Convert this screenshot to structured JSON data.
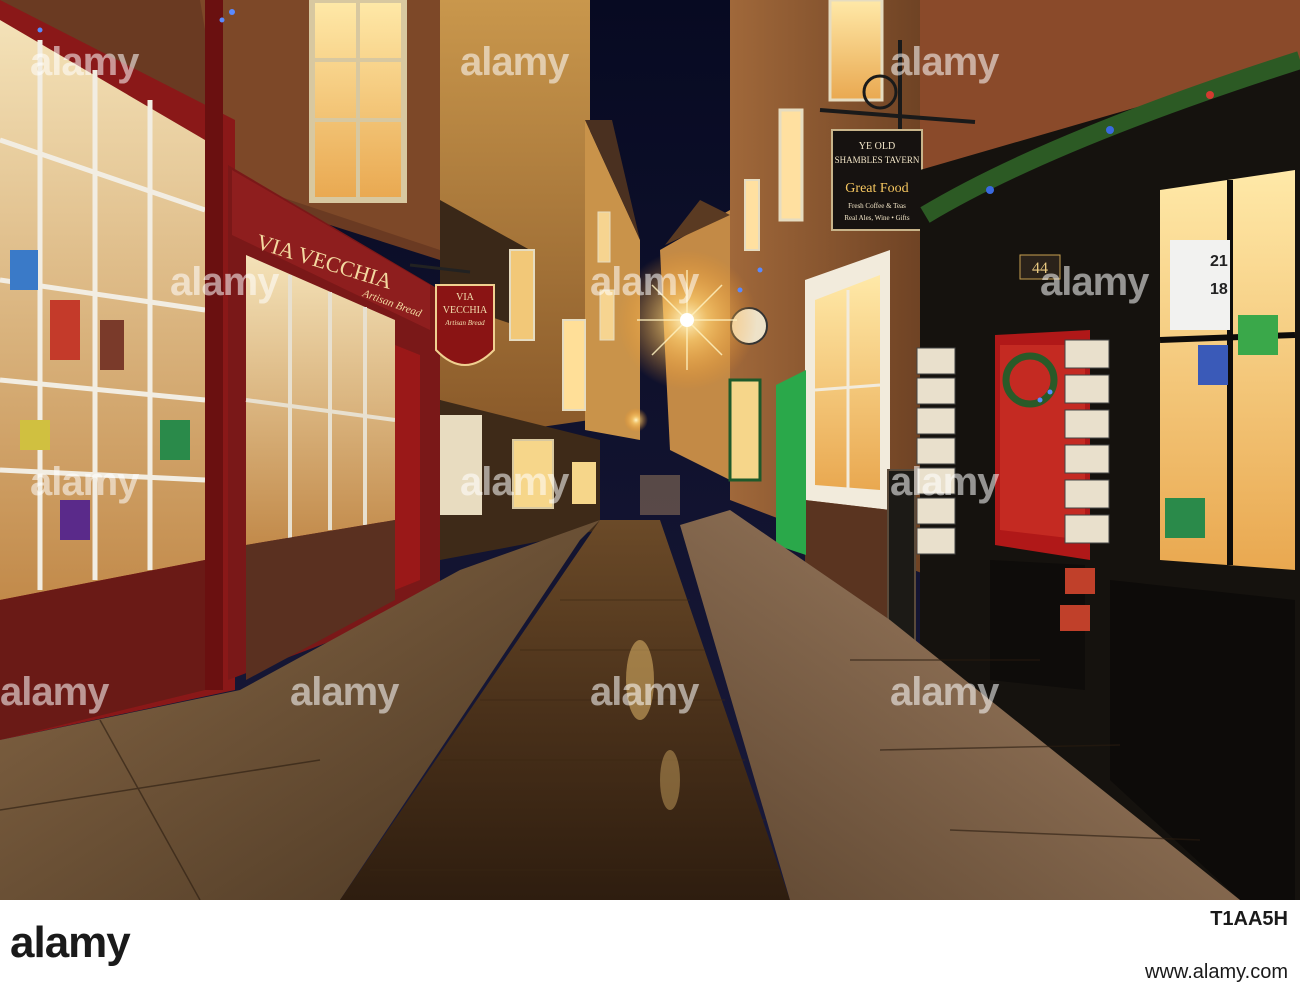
{
  "photo": {
    "description_colors": {
      "sky": "#0c1030",
      "warm_light": "#ffcf6a",
      "cobbles": "#5a3a1e",
      "shop_red": "#8a1a1a",
      "shop_black": "#15120e"
    },
    "signs": {
      "via_vecchia_fascia": "VIA VECCHIA",
      "via_vecchia_fascia_sub": "Artisan Bread",
      "hanging_sign_line1": "VIA",
      "hanging_sign_line2": "VECCHIA",
      "hanging_sign_line3": "Artisan Bread",
      "tavern_line1": "YE OLD",
      "tavern_line2": "SHAMBLES TAVERN",
      "tavern_line3": "Great Food",
      "tavern_line4": "Fresh Coffee & Teas",
      "tavern_line5": "Real Ales, Wine • Gifts",
      "door_number": "44",
      "window_sticker_21": "21",
      "window_sticker_18": "18"
    }
  },
  "watermark": {
    "text": "alamy"
  },
  "footer": {
    "logo": "alamy",
    "image_id": "T1AA5H",
    "url": "www.alamy.com"
  }
}
